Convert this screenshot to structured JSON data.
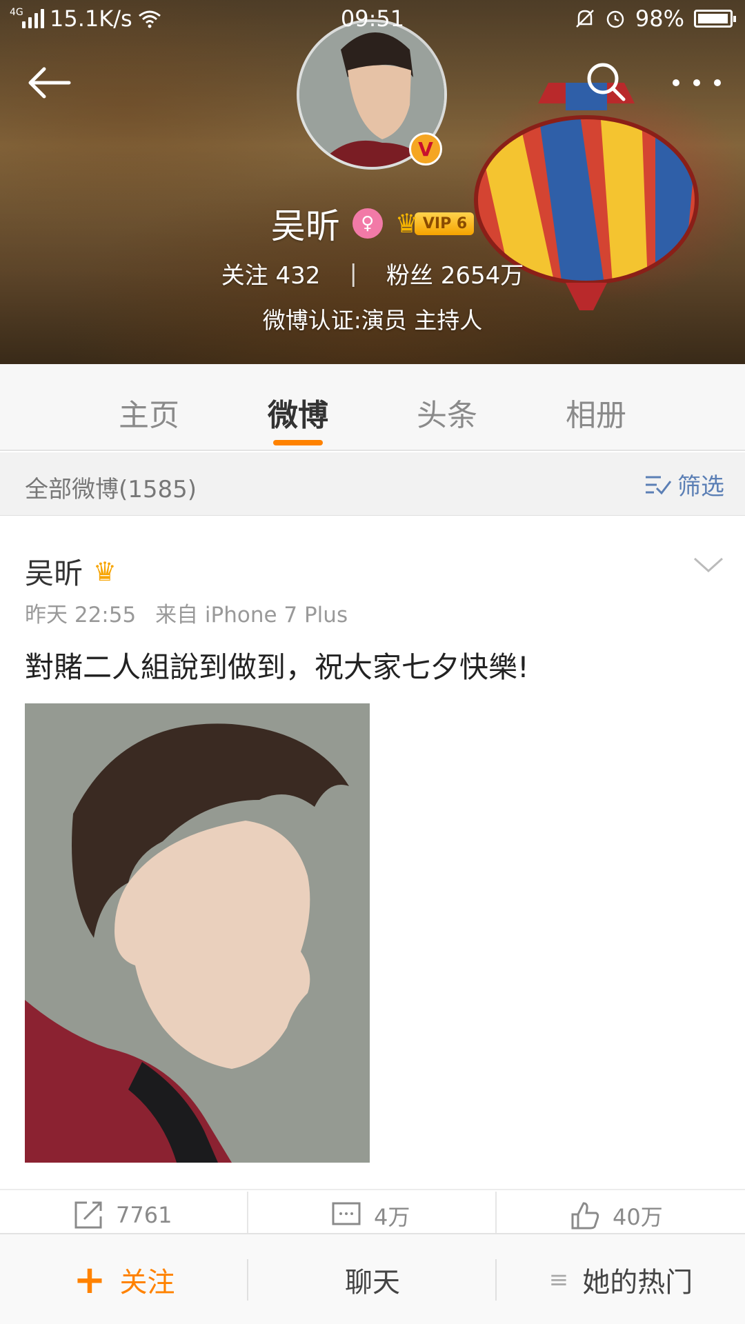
{
  "status_bar": {
    "network": "4G",
    "speed": "15.1K/s",
    "time": "09:51",
    "battery": "98%"
  },
  "profile": {
    "name": "吴昕",
    "vip_label": "VIP 6",
    "verified_badge": "V",
    "follow_label": "关注",
    "follow_count": "432",
    "fans_label": "粉丝",
    "fans_count": "2654万",
    "stats_divider": "|",
    "verification": "微博认证:演员 主持人"
  },
  "tabs": [
    {
      "label": "主页"
    },
    {
      "label": "微博"
    },
    {
      "label": "头条"
    },
    {
      "label": "相册"
    }
  ],
  "filter": {
    "count_text": "全部微博(1585)",
    "filter_label": "筛选"
  },
  "post": {
    "author": "吴昕",
    "time": "昨天 22:55",
    "source": "来自 iPhone 7 Plus",
    "text": "對賭二人組說到做到，祝大家七夕快樂!",
    "actions": {
      "repost_count": "7761",
      "comment_count": "4万",
      "like_count": "40万"
    }
  },
  "bottom_bar": {
    "follow_plus": "+",
    "follow_label": "关注",
    "chat_label": "聊天",
    "hot_icon": "≡",
    "hot_label": "她的热门"
  },
  "colors": {
    "accent": "#ff8200",
    "link_blue": "#5b7fb5",
    "vip_gold": "#f5a300",
    "female_pink": "#f27aa7"
  },
  "icons": [
    "back-arrow-icon",
    "search-icon",
    "more-icon",
    "gender-female-icon",
    "crown-icon",
    "filter-icon",
    "chevron-down-icon",
    "repost-icon",
    "comment-icon",
    "like-icon",
    "menu-lines-icon"
  ]
}
